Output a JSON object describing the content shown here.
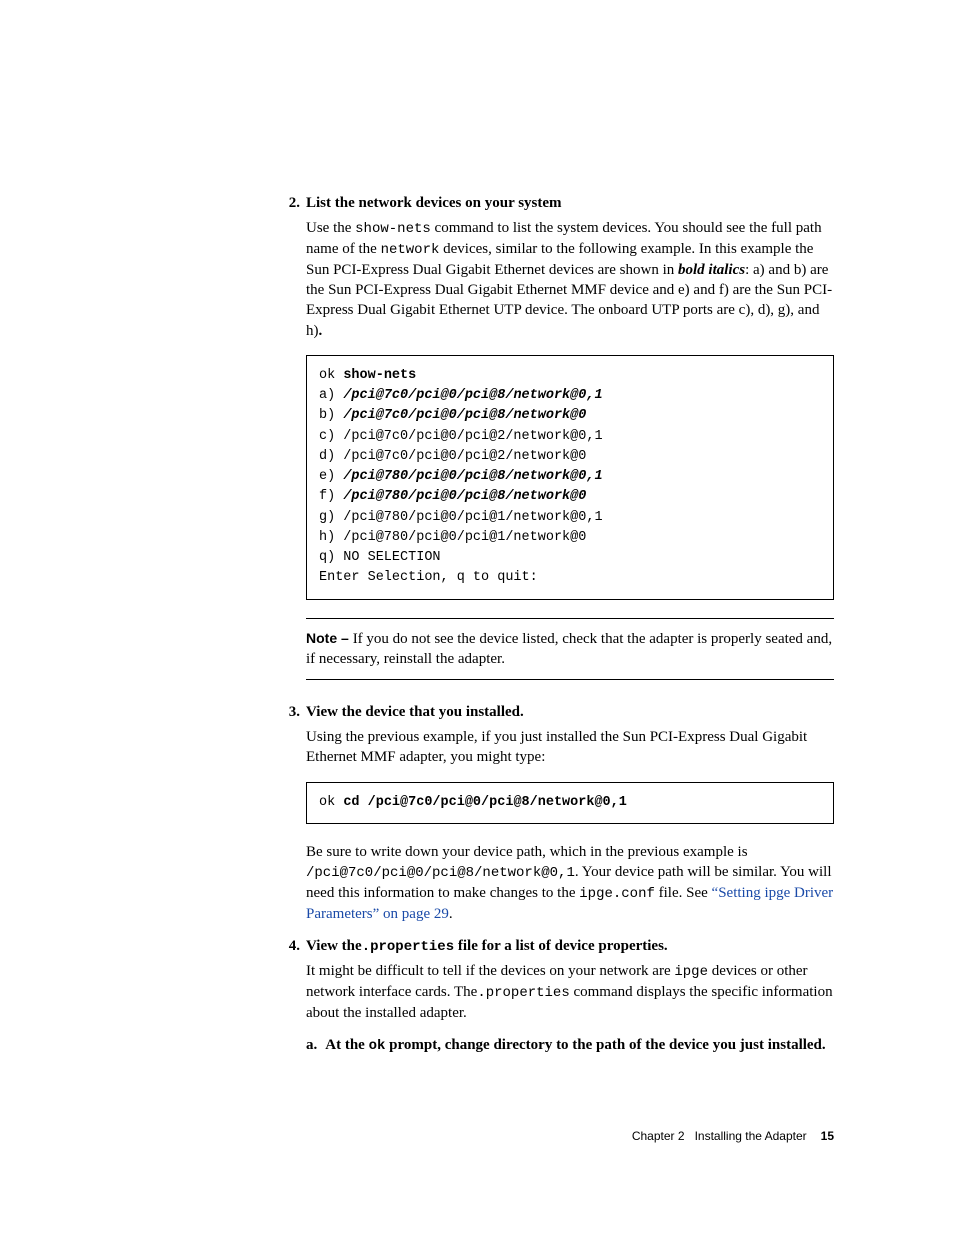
{
  "step2": {
    "num": "2.",
    "title": "List the network devices on your system",
    "body_pre": "Use the ",
    "body_cmd": "show-nets",
    "body_mid1": " command to list the system devices. You should see the full path name of the ",
    "body_mono2": "network",
    "body_mid2": " devices, similar to the following example. In this example the Sun PCI-Express Dual Gigabit Ethernet devices are shown in ",
    "body_bi": "bold italics",
    "body_mid3": ": a) and b) are the Sun PCI-Express Dual Gigabit Ethernet MMF device and e) and f) are the Sun PCI-Express Dual Gigabit Ethernet UTP device. The onboard UTP ports are c), d), g), and h)",
    "body_end": "."
  },
  "code1": {
    "l1a": "ok ",
    "l1b": "show-nets",
    "l2a": "a) ",
    "l2b": "/pci@7c0/pci@0/pci@8/network@0,1",
    "l3a": "b) ",
    "l3b": "/pci@7c0/pci@0/pci@8/network@0",
    "l4": "c) /pci@7c0/pci@0/pci@2/network@0,1",
    "l5": "d) /pci@7c0/pci@0/pci@2/network@0",
    "l6a": "e) ",
    "l6b": "/pci@780/pci@0/pci@8/network@0,1",
    "l7a": "f) ",
    "l7b": "/pci@780/pci@0/pci@8/network@0",
    "l8": "g) /pci@780/pci@0/pci@1/network@0,1",
    "l9": "h) /pci@780/pci@0/pci@1/network@0",
    "l10": "q) NO SELECTION",
    "l11": "Enter Selection, q to quit:"
  },
  "note": {
    "lead": "Note – ",
    "text": "If you do not see the device listed, check that the adapter is properly seated and, if necessary, reinstall the adapter."
  },
  "step3": {
    "num": "3.",
    "title": "View the device that you installed.",
    "body": "Using the previous example, if you just installed the Sun PCI-Express Dual Gigabit Ethernet MMF adapter, you might type:"
  },
  "code2": {
    "a": "ok ",
    "b": "cd /pci@7c0/pci@0/pci@8/network@0,1"
  },
  "step3b": {
    "pre": "Be sure to write down your device path, which in the previous example is ",
    "mono": "/pci@7c0/pci@0/pci@8/network@0,1",
    "mid1": ". Your device path will be similar. You will need this information to make changes to the ",
    "mono2": "ipge.conf",
    "mid2": " file. See ",
    "link": "“Setting ipge Driver Parameters” on page 29",
    "end": "."
  },
  "step4": {
    "num": "4.",
    "title_pre": "View the",
    "title_mono": ".properties",
    "title_post": " file for a list of device properties.",
    "body_pre": "It might be difficult to tell if the devices on your network are ",
    "body_mono1": "ipge",
    "body_mid1": " devices or other network interface cards. The",
    "body_mono2": ".properties",
    "body_mid2": " command displays the specific information about the installed adapter."
  },
  "sub_a": {
    "key": "a.",
    "pre": "At the ",
    "mono": "ok",
    "post": " prompt, change directory to the path of the device you just installed."
  },
  "footer": {
    "chapter": "Chapter 2",
    "title": "Installing the Adapter",
    "page": "15"
  }
}
